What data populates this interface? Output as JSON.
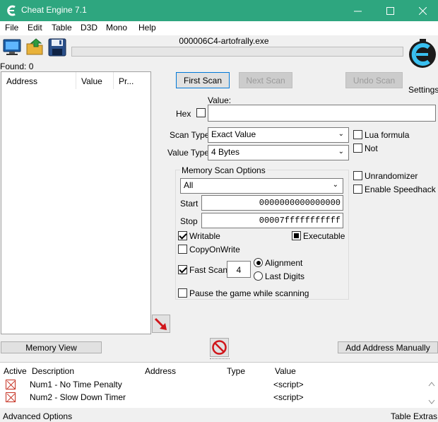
{
  "window": {
    "title": "Cheat Engine 7.1",
    "accent": "#2ea67f"
  },
  "menu": [
    "File",
    "Edit",
    "Table",
    "D3D",
    "Mono",
    "Help"
  ],
  "toolbar": {
    "process_title": "000006C4-artofrally.exe",
    "settings_label": "Settings"
  },
  "found": "Found: 0",
  "address_list": {
    "columns": [
      "Address",
      "Value",
      "Pr..."
    ]
  },
  "scan": {
    "first_scan": "First Scan",
    "next_scan": "Next Scan",
    "undo_scan": "Undo Scan",
    "value_label": "Value:",
    "hex_label": "Hex",
    "value": "",
    "scan_type_label": "Scan Type",
    "scan_type": "Exact Value",
    "value_type_label": "Value Type",
    "value_type": "4 Bytes",
    "lua_formula": "Lua formula",
    "not_label": "Not",
    "unrandomizer": "Unrandomizer",
    "enable_speedhack": "Enable Speedhack"
  },
  "mem_options": {
    "title": "Memory Scan Options",
    "region": "All",
    "start_label": "Start",
    "start_value": "0000000000000000",
    "stop_label": "Stop",
    "stop_value": "00007fffffffffff",
    "writable": "Writable",
    "executable": "Executable",
    "copy_on_write": "CopyOnWrite",
    "fast_scan": "Fast Scan",
    "fast_scan_value": "4",
    "alignment": "Alignment",
    "last_digits": "Last Digits",
    "pause_game": "Pause the game while scanning"
  },
  "actions": {
    "memory_view": "Memory View",
    "add_address": "Add Address Manually"
  },
  "cheat_table": {
    "columns": [
      "Active",
      "Description",
      "Address",
      "Type",
      "Value"
    ],
    "rows": [
      {
        "description": "Num1 - No Time Penalty",
        "value": "<script>"
      },
      {
        "description": "Num2 - Slow Down Timer",
        "value": "<script>"
      }
    ]
  },
  "status": {
    "left": "Advanced Options",
    "right": "Table Extras"
  }
}
